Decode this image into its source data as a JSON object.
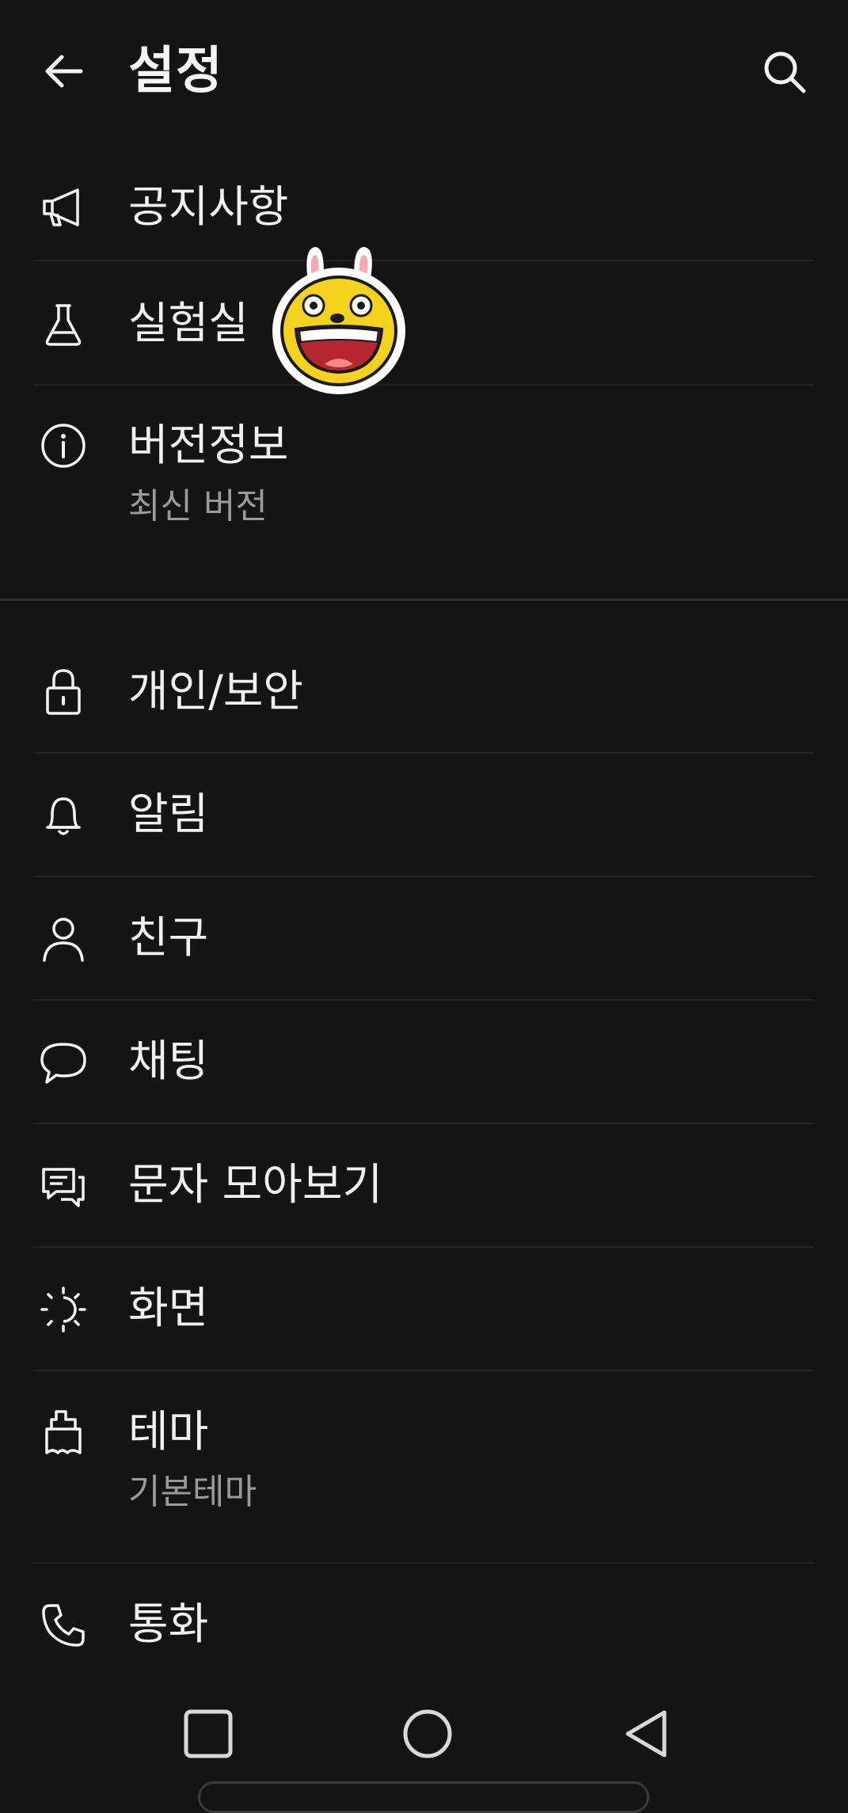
{
  "header": {
    "title": "설정",
    "back_icon": "arrow-left-icon",
    "search_icon": "search-icon"
  },
  "section1": [
    {
      "id": "notice",
      "label": "공지사항",
      "icon": "megaphone-icon"
    },
    {
      "id": "lab",
      "label": "실험실",
      "icon": "flask-icon"
    },
    {
      "id": "version",
      "label": "버전정보",
      "sublabel": "최신 버전",
      "icon": "info-icon"
    }
  ],
  "section2": [
    {
      "id": "privacy",
      "label": "개인/보안",
      "icon": "lock-icon"
    },
    {
      "id": "alarm",
      "label": "알림",
      "icon": "bell-icon"
    },
    {
      "id": "friends",
      "label": "친구",
      "icon": "person-icon"
    },
    {
      "id": "chat",
      "label": "채팅",
      "icon": "speech-bubble-icon"
    },
    {
      "id": "sms",
      "label": "문자 모아보기",
      "icon": "message-stack-icon"
    },
    {
      "id": "display",
      "label": "화면",
      "icon": "brightness-icon"
    },
    {
      "id": "theme",
      "label": "테마",
      "sublabel": "기본테마",
      "icon": "brush-icon"
    },
    {
      "id": "call",
      "label": "통화",
      "icon": "phone-icon"
    }
  ],
  "sticker": "lab-sticker-character",
  "navbar": {
    "recents_icon": "square-recents-icon",
    "home_icon": "circle-home-icon",
    "back_icon": "triangle-back-icon"
  },
  "colors": {
    "background": "#141414",
    "text": "#f0f0f0",
    "subtext": "#9a9a9a",
    "divider": "#232323",
    "sticker_yellow": "#f5d21e"
  }
}
